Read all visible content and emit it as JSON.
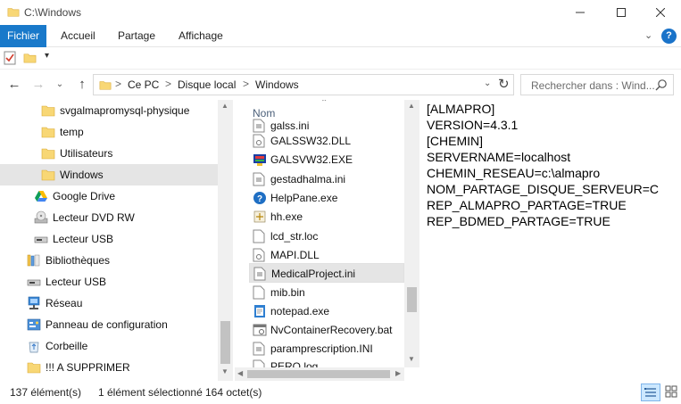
{
  "window": {
    "title": "C:\\Windows"
  },
  "ribbon": {
    "tabs": [
      {
        "label": "Fichier"
      },
      {
        "label": "Accueil"
      },
      {
        "label": "Partage"
      },
      {
        "label": "Affichage"
      }
    ],
    "help_label": "?"
  },
  "address": {
    "segments": [
      "Ce PC",
      "Disque local",
      "Windows"
    ],
    "separator": ">"
  },
  "search": {
    "placeholder": "Rechercher dans : Wind..."
  },
  "nav_pane": {
    "items": [
      {
        "label": "svgalmapromysql-physique",
        "icon": "folder-icon",
        "selected": false
      },
      {
        "label": "temp",
        "icon": "folder-icon",
        "selected": false
      },
      {
        "label": "Utilisateurs",
        "icon": "folder-icon",
        "selected": false
      },
      {
        "label": "Windows",
        "icon": "folder-icon",
        "selected": true
      },
      {
        "label": "Google Drive",
        "icon": "google-drive-icon",
        "selected": false
      },
      {
        "label": "Lecteur DVD RW",
        "icon": "dvd-drive-icon",
        "selected": false
      },
      {
        "label": "Lecteur USB",
        "icon": "usb-drive-icon",
        "selected": false
      },
      {
        "label": "Bibliothèques",
        "icon": "libraries-icon",
        "selected": false
      },
      {
        "label": "Lecteur USB",
        "icon": "usb-drive-icon",
        "selected": false
      },
      {
        "label": "Réseau",
        "icon": "network-icon",
        "selected": false
      },
      {
        "label": "Panneau de configuration",
        "icon": "control-panel-icon",
        "selected": false
      },
      {
        "label": "Corbeille",
        "icon": "recycle-bin-icon",
        "selected": false
      },
      {
        "label": "!!! A SUPPRIMER",
        "icon": "folder-icon",
        "selected": false
      }
    ]
  },
  "file_list": {
    "column_header": "Nom",
    "items": [
      {
        "name": "galss.ini",
        "icon": "ini-file-icon",
        "selected": false
      },
      {
        "name": "GALSSW32.DLL",
        "icon": "dll-file-icon",
        "selected": false
      },
      {
        "name": "GALSVW32.EXE",
        "icon": "exe-app-icon",
        "selected": false
      },
      {
        "name": "gestadhalma.ini",
        "icon": "ini-file-icon",
        "selected": false
      },
      {
        "name": "HelpPane.exe",
        "icon": "help-icon",
        "selected": false
      },
      {
        "name": "hh.exe",
        "icon": "exe-file-icon",
        "selected": false
      },
      {
        "name": "lcd_str.loc",
        "icon": "file-icon",
        "selected": false
      },
      {
        "name": "MAPI.DLL",
        "icon": "dll-file-icon",
        "selected": false
      },
      {
        "name": "MedicalProject.ini",
        "icon": "ini-file-icon",
        "selected": true
      },
      {
        "name": "mib.bin",
        "icon": "file-icon",
        "selected": false
      },
      {
        "name": "notepad.exe",
        "icon": "notepad-icon",
        "selected": false
      },
      {
        "name": "NvContainerRecovery.bat",
        "icon": "bat-file-icon",
        "selected": false
      },
      {
        "name": "paramprescription.INI",
        "icon": "ini-file-icon",
        "selected": false
      },
      {
        "name": "PERO.log",
        "icon": "file-icon",
        "selected": false
      }
    ]
  },
  "preview": {
    "lines": [
      "[ALMAPRO]",
      "VERSION=4.3.1",
      "[CHEMIN]",
      "SERVERNAME=localhost",
      "CHEMIN_RESEAU=c:\\almapro",
      "NOM_PARTAGE_DISQUE_SERVEUR=C",
      "REP_ALMAPRO_PARTAGE=TRUE",
      "REP_BDMED_PARTAGE=TRUE"
    ]
  },
  "status": {
    "count": "137 élément(s)",
    "selected": "1 élément sélectionné",
    "size": "164 octet(s)"
  },
  "colors": {
    "accent": "#1979ca",
    "selection": "#cce8ff",
    "folder": "#f8d775"
  }
}
